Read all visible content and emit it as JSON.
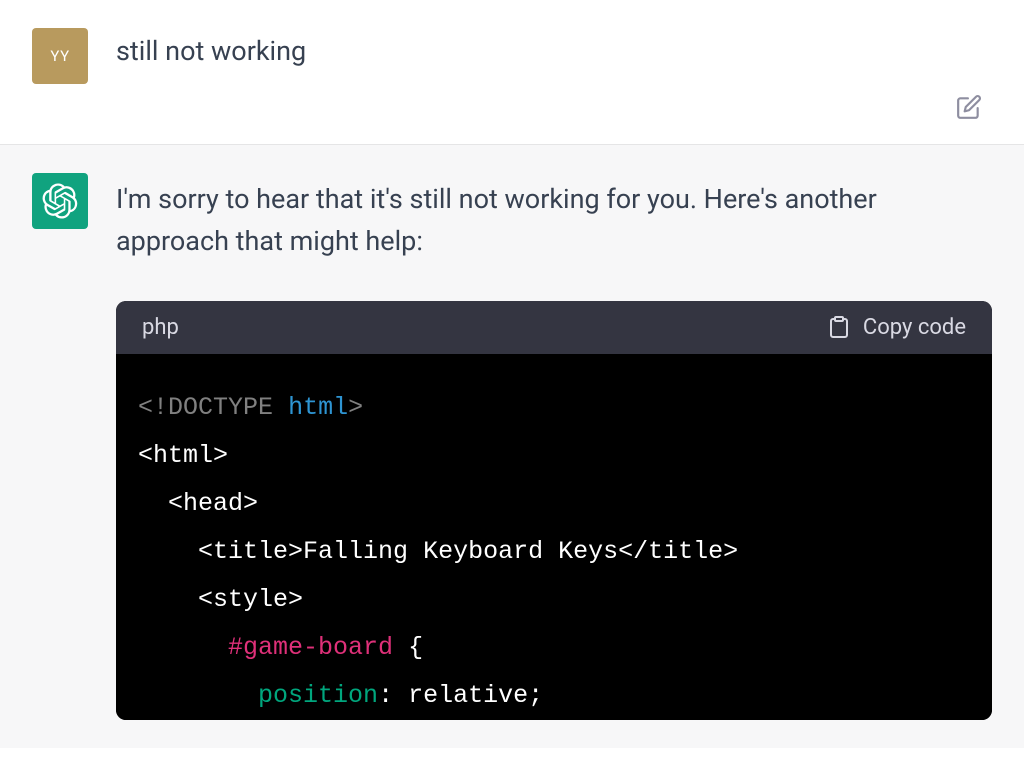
{
  "user": {
    "avatar_initials": "YY",
    "message": "still not working"
  },
  "assistant": {
    "message": "I'm sorry to hear that it's still not working for you. Here's another approach that might help:",
    "code_block": {
      "language": "php",
      "copy_label": "Copy code",
      "tokens": {
        "doctype_open": "<!",
        "doctype_word": "DOCTYPE",
        "doctype_html": "html",
        "doctype_close": ">",
        "html_open": "<html>",
        "head_open": "<head>",
        "title_open": "<title>",
        "title_text": "Falling Keyboard Keys",
        "title_close": "</title>",
        "style_open": "<style>",
        "selector": "#game-board",
        "brace_open": "{",
        "prop_position": "position",
        "colon": ":",
        "val_relative": "relative",
        "semicolon": ";"
      }
    }
  }
}
